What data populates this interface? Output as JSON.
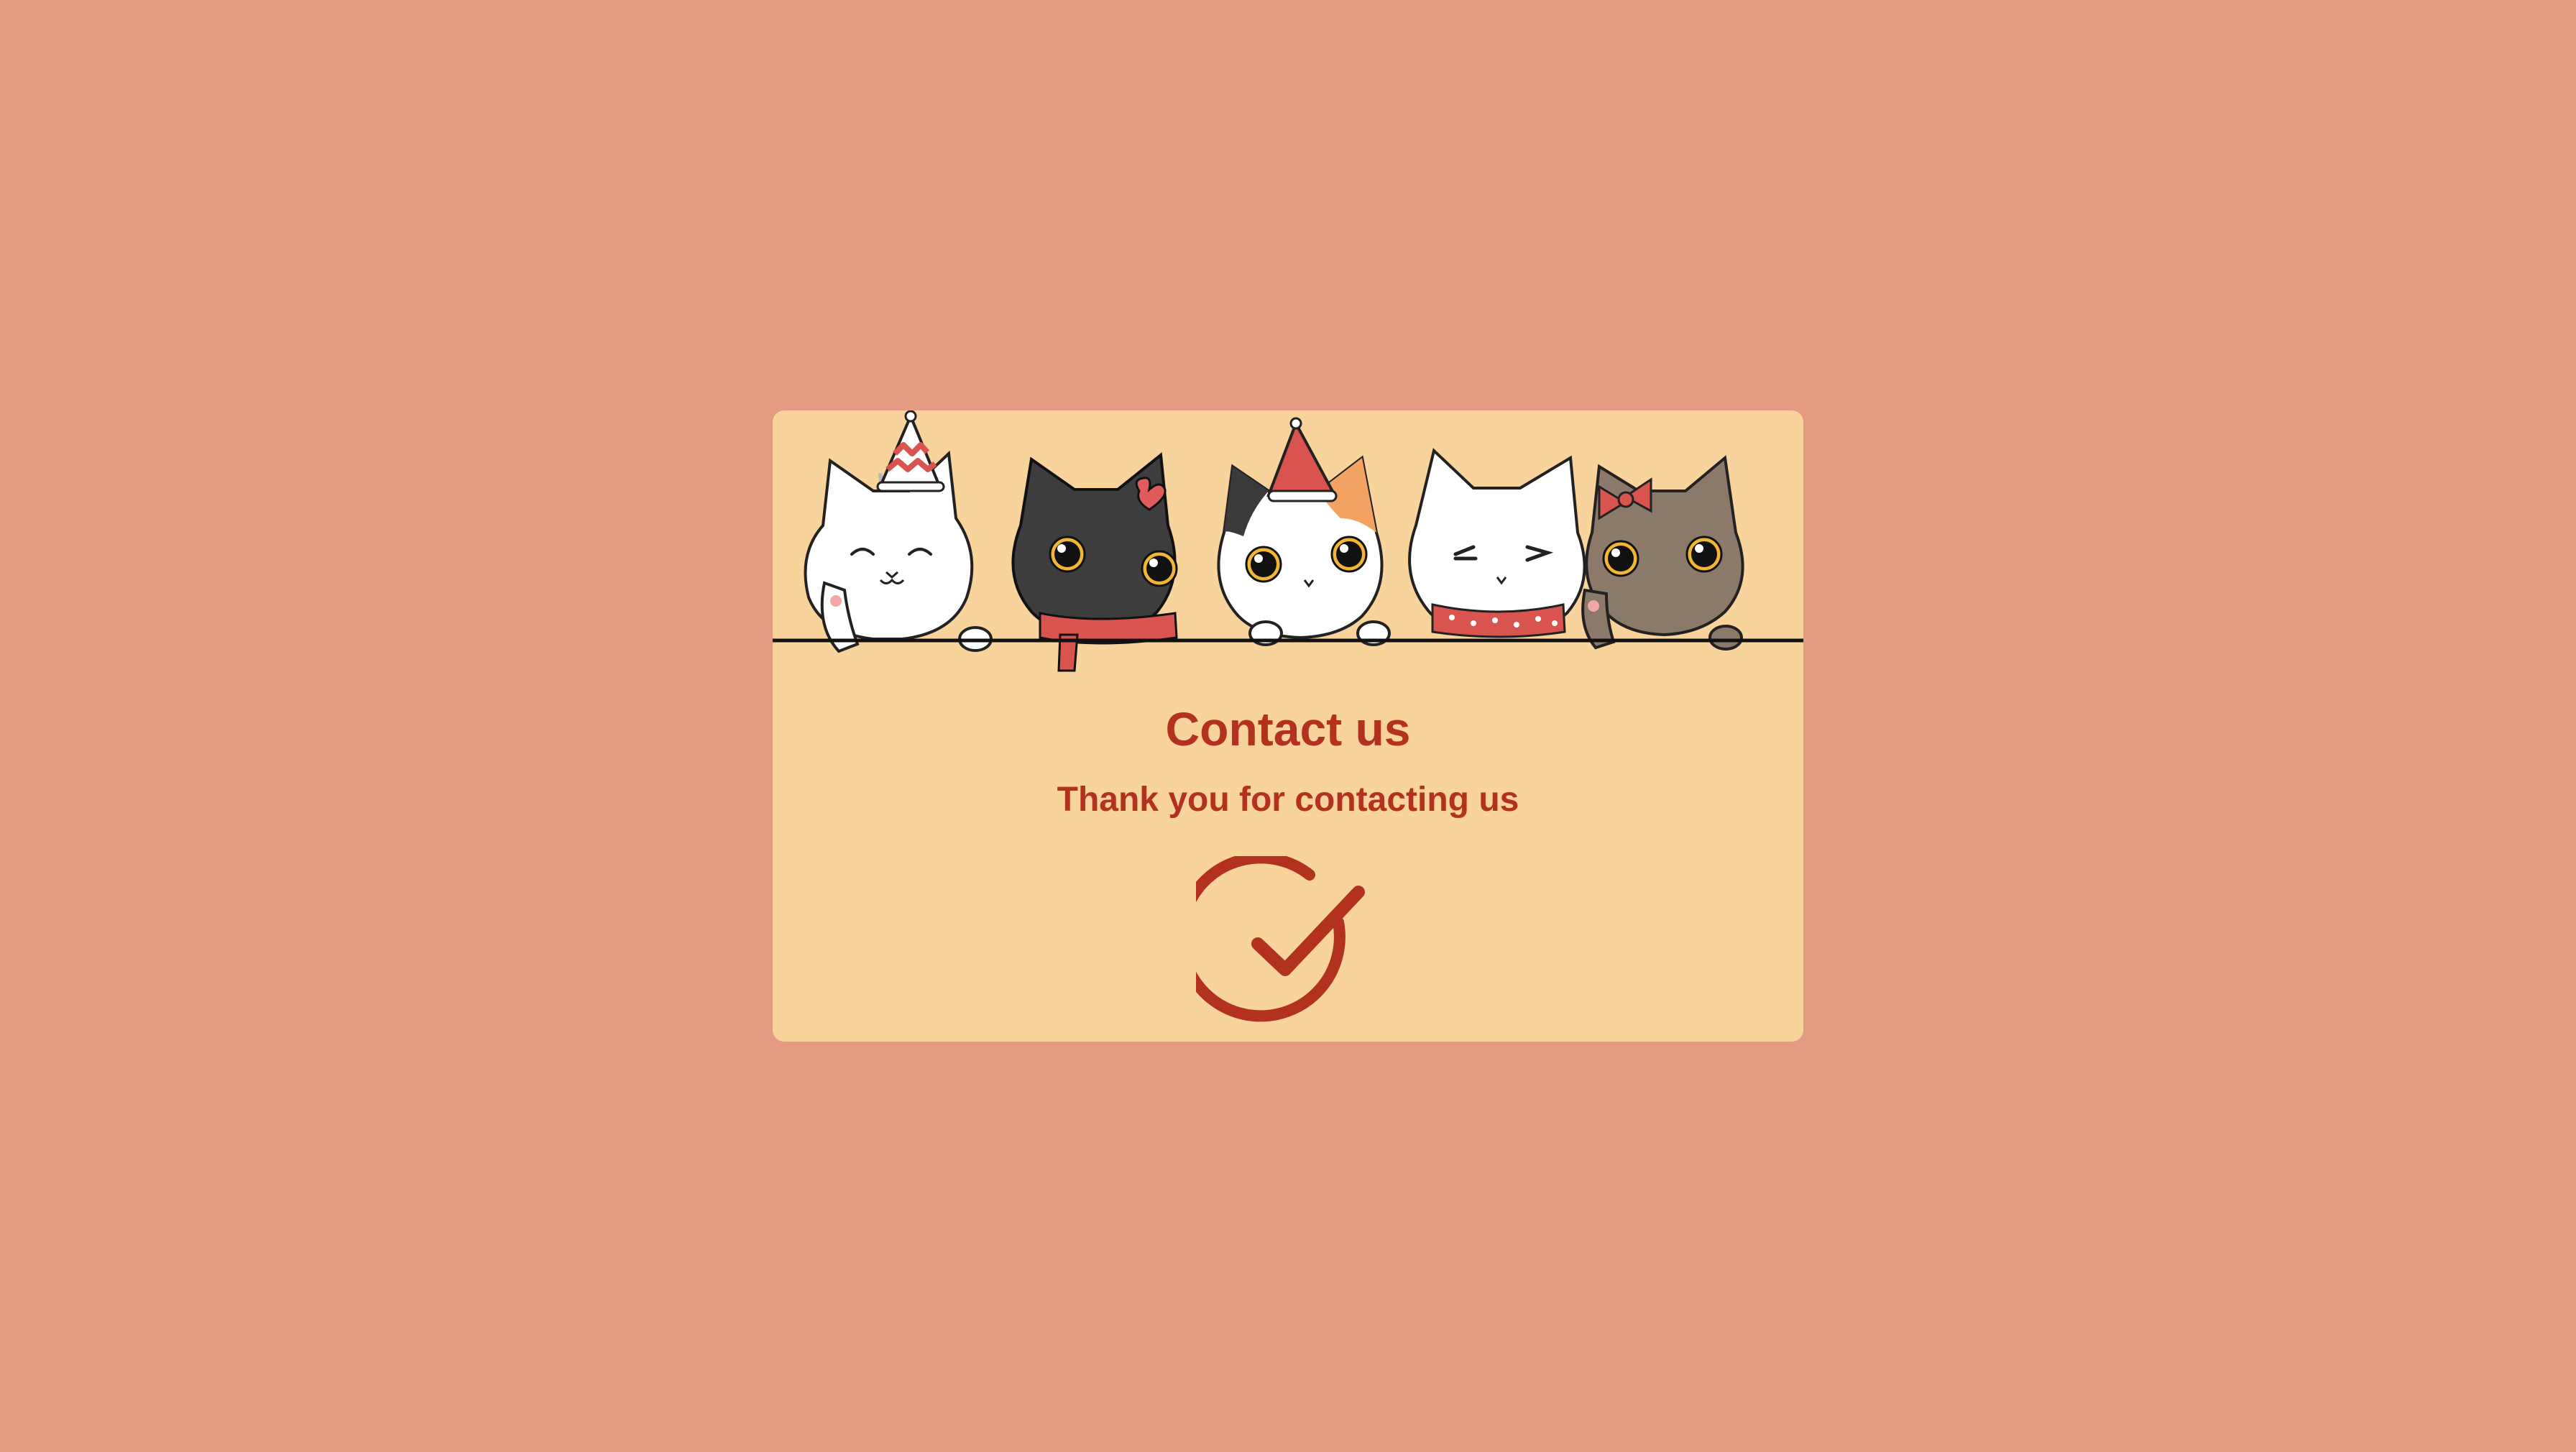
{
  "card": {
    "title": "Contact us",
    "subtitle": "Thank you for contacting us"
  },
  "banner": {
    "illustration": "five-cartoon-cats-peeking-over-ledge"
  },
  "icons": {
    "success": "check-circle-icon"
  },
  "colors": {
    "page_background": "#e49b82",
    "card_background": "#f8d39c",
    "accent": "#b3321f"
  }
}
